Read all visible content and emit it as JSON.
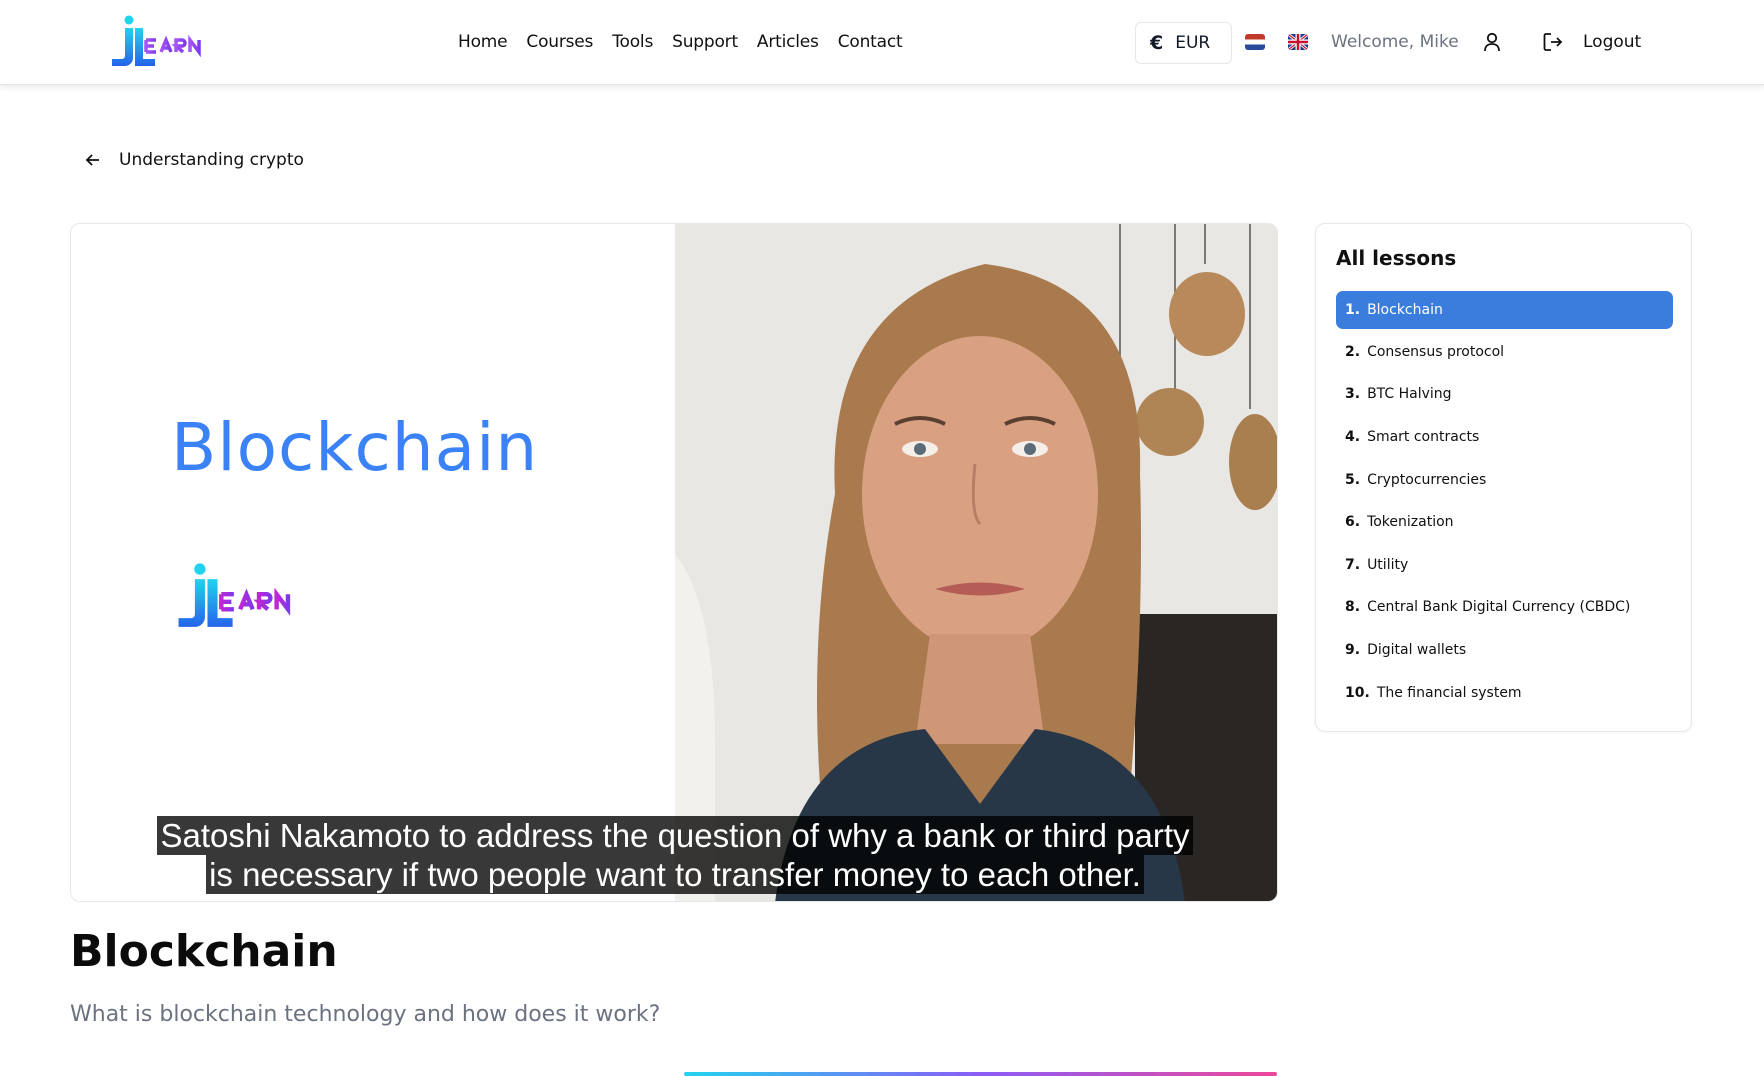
{
  "header": {
    "logo_text": "jLEARN",
    "nav": [
      "Home",
      "Courses",
      "Tools",
      "Support",
      "Articles",
      "Contact"
    ],
    "currency_symbol": "€",
    "currency": "EUR",
    "welcome": "Welcome, Mike",
    "logout": "Logout"
  },
  "breadcrumb": {
    "back_label": "Understanding crypto"
  },
  "video": {
    "slide_title": "Blockchain",
    "caption_lines": [
      "Satoshi Nakamoto to address the question of why a bank or third party",
      "is necessary if two people want to transfer money to each other."
    ]
  },
  "sidebar": {
    "title": "All lessons",
    "lessons": [
      {
        "num": "1.",
        "label": "Blockchain"
      },
      {
        "num": "2.",
        "label": "Consensus protocol"
      },
      {
        "num": "3.",
        "label": "BTC Halving"
      },
      {
        "num": "4.",
        "label": "Smart contracts"
      },
      {
        "num": "5.",
        "label": "Cryptocurrencies"
      },
      {
        "num": "6.",
        "label": "Tokenization"
      },
      {
        "num": "7.",
        "label": "Utility"
      },
      {
        "num": "8.",
        "label": "Central Bank Digital Currency (CBDC)"
      },
      {
        "num": "9.",
        "label": "Digital wallets"
      },
      {
        "num": "10.",
        "label": "The financial system"
      }
    ],
    "active_index": 0
  },
  "lesson": {
    "title": "Blockchain",
    "subtitle": "What is blockchain technology and how does it work?"
  },
  "colors": {
    "accent": "#3b7ddd",
    "title_blue": "#3b82f6"
  }
}
